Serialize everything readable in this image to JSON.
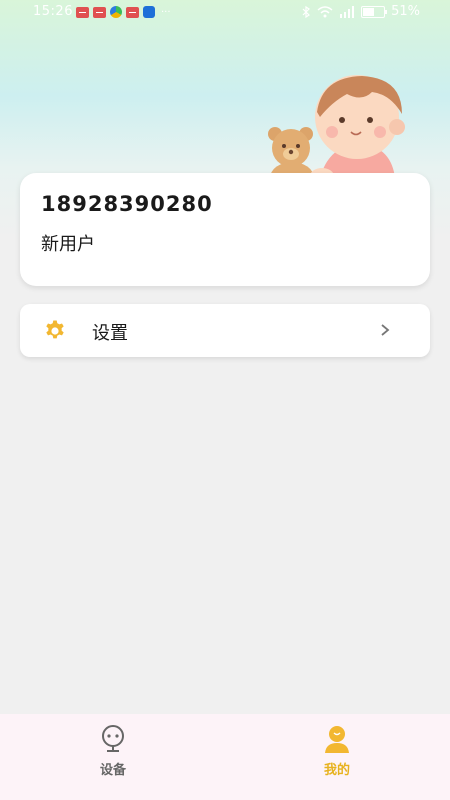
{
  "status_bar": {
    "time": "15:26",
    "battery": "51%"
  },
  "profile": {
    "phone": "18928390280",
    "nickname": "新用户"
  },
  "settings": {
    "label": "设置"
  },
  "tabs": [
    {
      "label": "设备",
      "icon": "device-face-icon",
      "active": false
    },
    {
      "label": "我的",
      "icon": "user-icon",
      "active": true
    }
  ],
  "colors": {
    "accent": "#e7b21f",
    "inactive": "#666666",
    "tabbar_bg": "#fdf3f8"
  }
}
